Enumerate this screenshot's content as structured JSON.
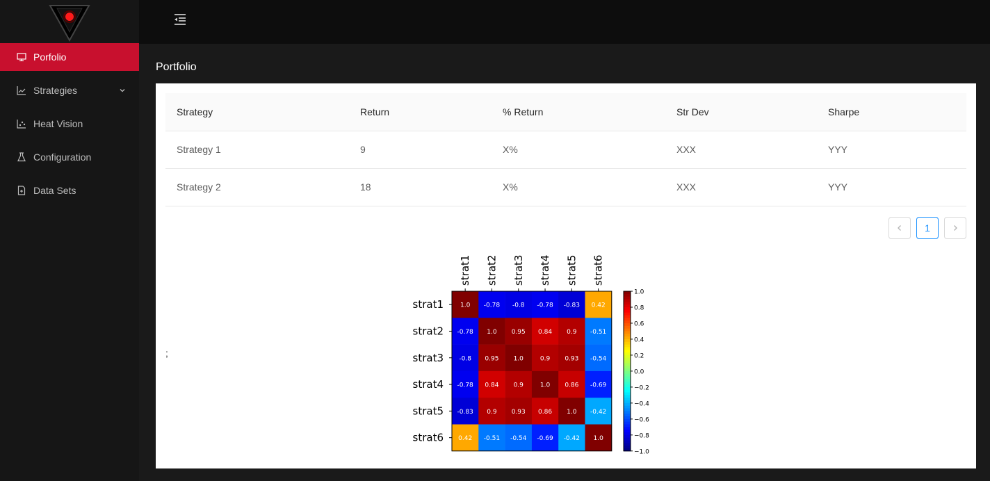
{
  "sidebar": {
    "logo": "logo-triangle-red-eye",
    "items": [
      {
        "label": "Porfolio",
        "icon": "desktop-icon",
        "active": true
      },
      {
        "label": "Strategies",
        "icon": "line-chart-icon",
        "has_submenu": true
      },
      {
        "label": "Heat Vision",
        "icon": "dot-chart-icon"
      },
      {
        "label": "Configuration",
        "icon": "experiment-icon"
      },
      {
        "label": "Data Sets",
        "icon": "file-icon"
      }
    ]
  },
  "header": {
    "trigger_icon": "menu-fold-icon"
  },
  "page": {
    "title": "Portfolio"
  },
  "table": {
    "columns": [
      "Strategy",
      "Return",
      "% Return",
      "Str Dev",
      "Sharpe"
    ],
    "rows": [
      [
        "Strategy 1",
        "9",
        "X%",
        "XXX",
        "YYY"
      ],
      [
        "Strategy 2",
        "18",
        "X%",
        "XXX",
        "YYY"
      ]
    ]
  },
  "pagination": {
    "current": "1"
  },
  "stray_text": ";",
  "colors": {
    "accent": "#c8102e",
    "sidebar_bg": "#161616",
    "header_bg": "#0d0d0d",
    "body_bg": "#1a1a1a",
    "link": "#1890ff"
  },
  "chart_data": {
    "type": "heatmap",
    "x": [
      "strat1",
      "strat2",
      "strat3",
      "strat4",
      "strat5",
      "strat6"
    ],
    "y": [
      "strat1",
      "strat2",
      "strat3",
      "strat4",
      "strat5",
      "strat6"
    ],
    "values": [
      [
        1.0,
        -0.78,
        -0.8,
        -0.78,
        -0.83,
        0.42
      ],
      [
        -0.78,
        1.0,
        0.95,
        0.84,
        0.9,
        -0.51
      ],
      [
        -0.8,
        0.95,
        1.0,
        0.9,
        0.93,
        -0.54
      ],
      [
        -0.78,
        0.84,
        0.9,
        1.0,
        0.86,
        -0.69
      ],
      [
        -0.83,
        0.9,
        0.93,
        0.86,
        1.0,
        -0.42
      ],
      [
        0.42,
        -0.51,
        -0.54,
        -0.69,
        -0.42,
        1.0
      ]
    ],
    "value_labels": [
      [
        "1.0",
        "-0.78",
        "-0.8",
        "-0.78",
        "-0.83",
        "0.42"
      ],
      [
        "-0.78",
        "1.0",
        "0.95",
        "0.84",
        "0.9",
        "-0.51"
      ],
      [
        "-0.8",
        "0.95",
        "1.0",
        "0.9",
        "0.93",
        "-0.54"
      ],
      [
        "-0.78",
        "0.84",
        "0.9",
        "1.0",
        "0.86",
        "-0.69"
      ],
      [
        "-0.83",
        "0.9",
        "0.93",
        "0.86",
        "1.0",
        "-0.42"
      ],
      [
        "0.42",
        "-0.51",
        "-0.54",
        "-0.69",
        "-0.42",
        "1.0"
      ]
    ],
    "colorbar": {
      "range": [
        -1.0,
        1.0
      ],
      "ticks": [
        "1.0",
        "0.8",
        "0.6",
        "0.4",
        "0.2",
        "0.0",
        "−0.2",
        "−0.4",
        "−0.6",
        "−0.8",
        "−1.0"
      ],
      "colormap": "jet"
    },
    "title": "",
    "xlabel": "",
    "ylabel": ""
  }
}
